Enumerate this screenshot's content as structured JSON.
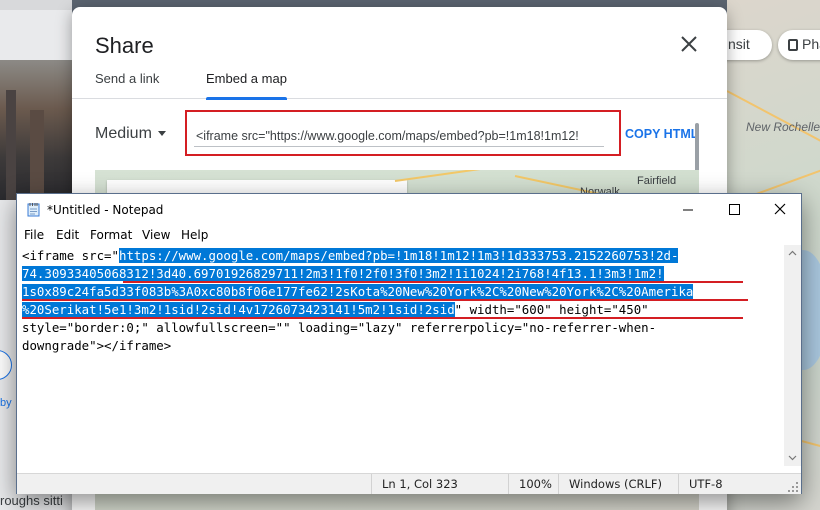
{
  "background": {
    "left_snippet_by": "by",
    "left_snippet_text": "roughs sitti",
    "chips": [
      "nsit",
      "Pha"
    ],
    "map_labels": [
      "New Rochelle"
    ]
  },
  "share_dialog": {
    "title": "Share",
    "tabs": [
      {
        "label": "Send a link",
        "active": false
      },
      {
        "label": "Embed a map",
        "active": true
      }
    ],
    "size_selector": "Medium",
    "embed_code": "<iframe src=\"https://www.google.com/maps/embed?pb=!1m18!1m12!",
    "copy_label": "COPY HTML",
    "preview_labels": [
      "Norwalk",
      "Fairfield"
    ]
  },
  "notepad": {
    "title": "*Untitled - Notepad",
    "menu": [
      "File",
      "Edit",
      "Format",
      "View",
      "Help"
    ],
    "lines": [
      {
        "plain": "<iframe src=\"",
        "selected": "https://www.google.com/maps/embed?pb=!1m18!1m12!1m3!1d333753.2152260753!2d-",
        "after": ""
      },
      {
        "plain": "",
        "selected": "74.30933405068312!3d40.69701926829711!2m3!1f0!2f0!3f0!3m2!1i1024!2i768!4f13.1!3m3!1m2!",
        "after": ""
      },
      {
        "plain": "",
        "selected": "1s0x89c24fa5d33f083b%3A0xc80b8f06e177fe62!2sKota%20New%20York%2C%20New%20York%2C%20Amerika",
        "after": ""
      },
      {
        "plain": "",
        "selected": "%20Serikat!5e1!3m2!1sid!2sid!4v1726073423141!5m2!1sid!2sid",
        "after": "\" width=\"600\" height=\"450\""
      },
      {
        "plain": "style=\"border:0;\" allowfullscreen=\"\" loading=\"lazy\" referrerpolicy=\"no-referrer-when-",
        "selected": "",
        "after": ""
      },
      {
        "plain": "downgrade\"></iframe>",
        "selected": "",
        "after": ""
      }
    ],
    "status": {
      "position": "Ln 1, Col 323",
      "zoom": "100%",
      "line_ending": "Windows (CRLF)",
      "encoding": "UTF-8"
    }
  },
  "colors": {
    "selection": "#0078d7",
    "highlight_box": "#d41e23",
    "link_blue": "#1a73e8"
  }
}
